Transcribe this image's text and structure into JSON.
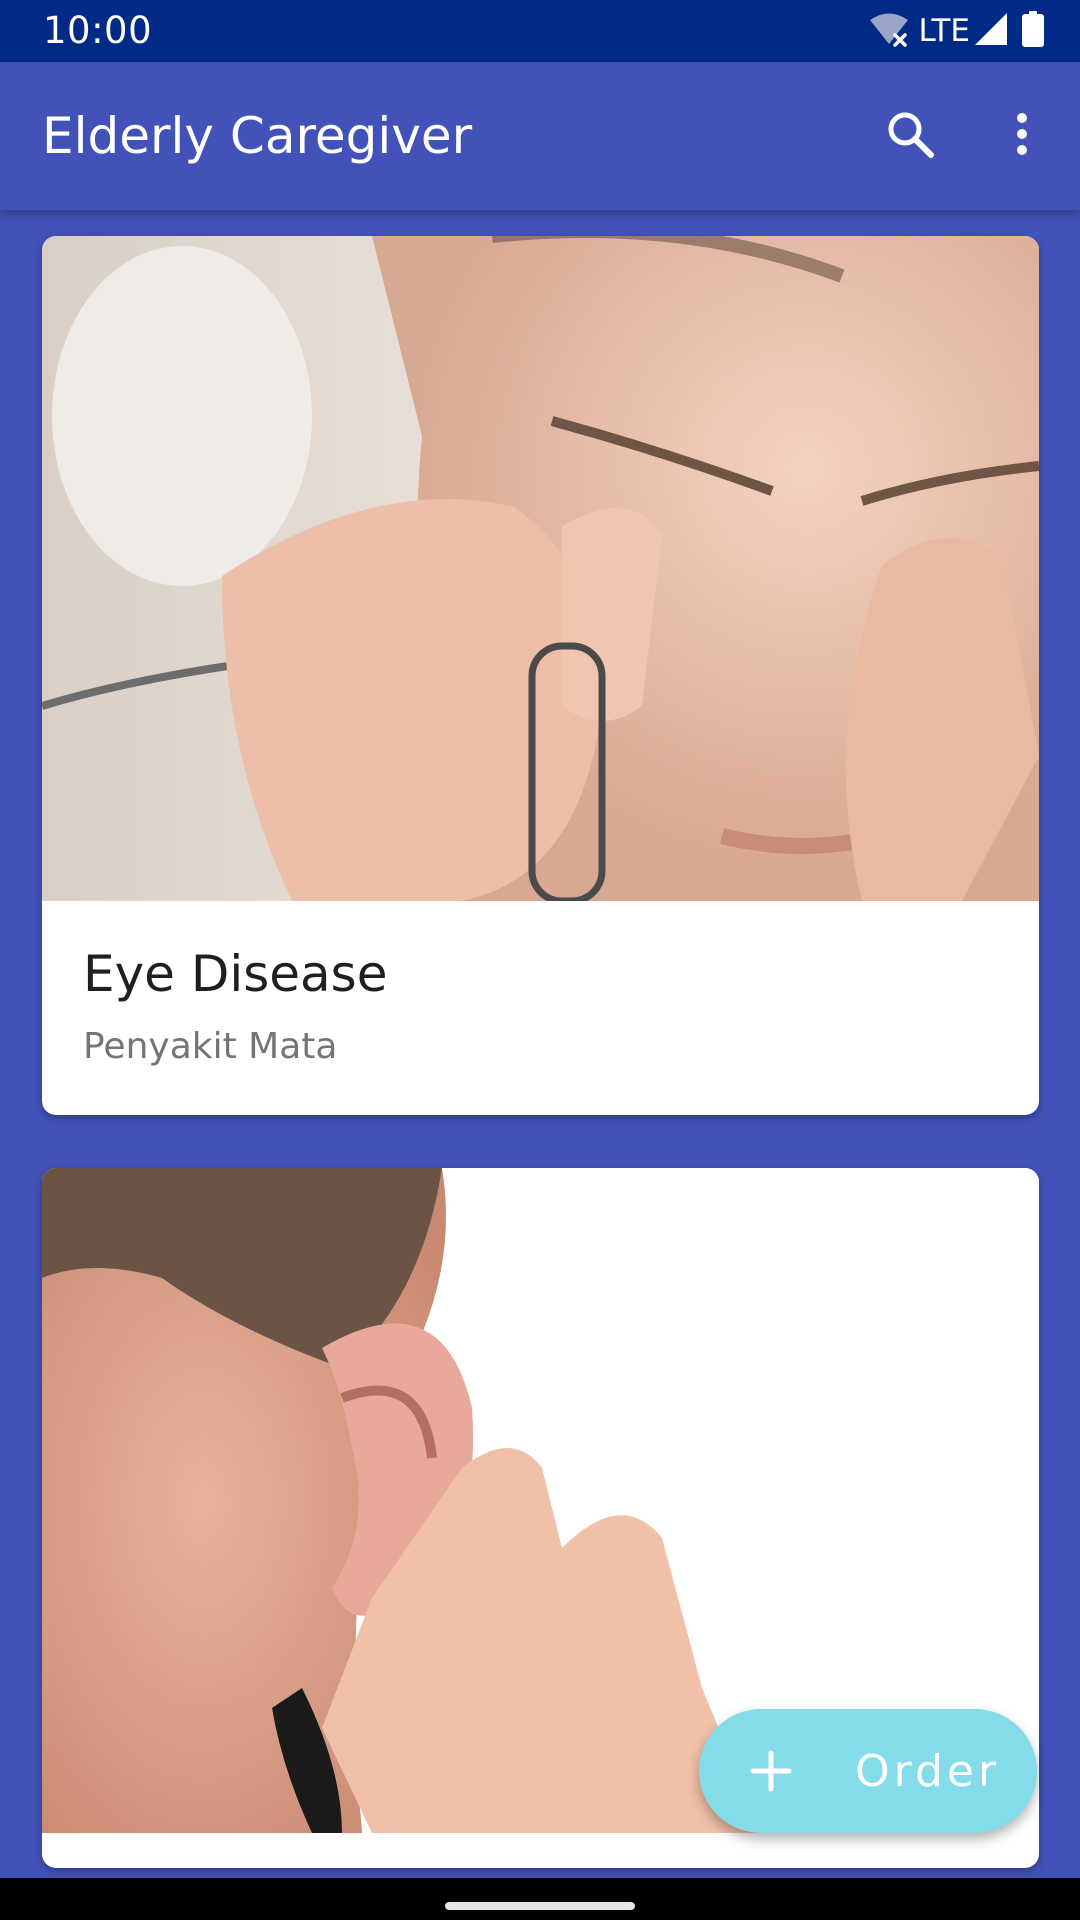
{
  "status_bar": {
    "time": "10:00",
    "network": "LTE",
    "icons": [
      "wifi-off-icon",
      "cell-signal-icon",
      "battery-icon"
    ]
  },
  "app_bar": {
    "title": "Elderly Caregiver",
    "icons": [
      "search-icon",
      "more-vert-icon"
    ]
  },
  "cards": [
    {
      "title": "Eye Disease",
      "subtitle": "Penyakit Mata",
      "image": "person-rubbing-eyes-holding-glasses"
    },
    {
      "image": "hand-cupped-behind-ear"
    }
  ],
  "fab": {
    "icon": "plus-icon",
    "label": "Order"
  },
  "colors": {
    "status_bar": "#012a87",
    "primary": "#4352b8",
    "fab": "#84dbe9",
    "card": "#ffffff"
  }
}
